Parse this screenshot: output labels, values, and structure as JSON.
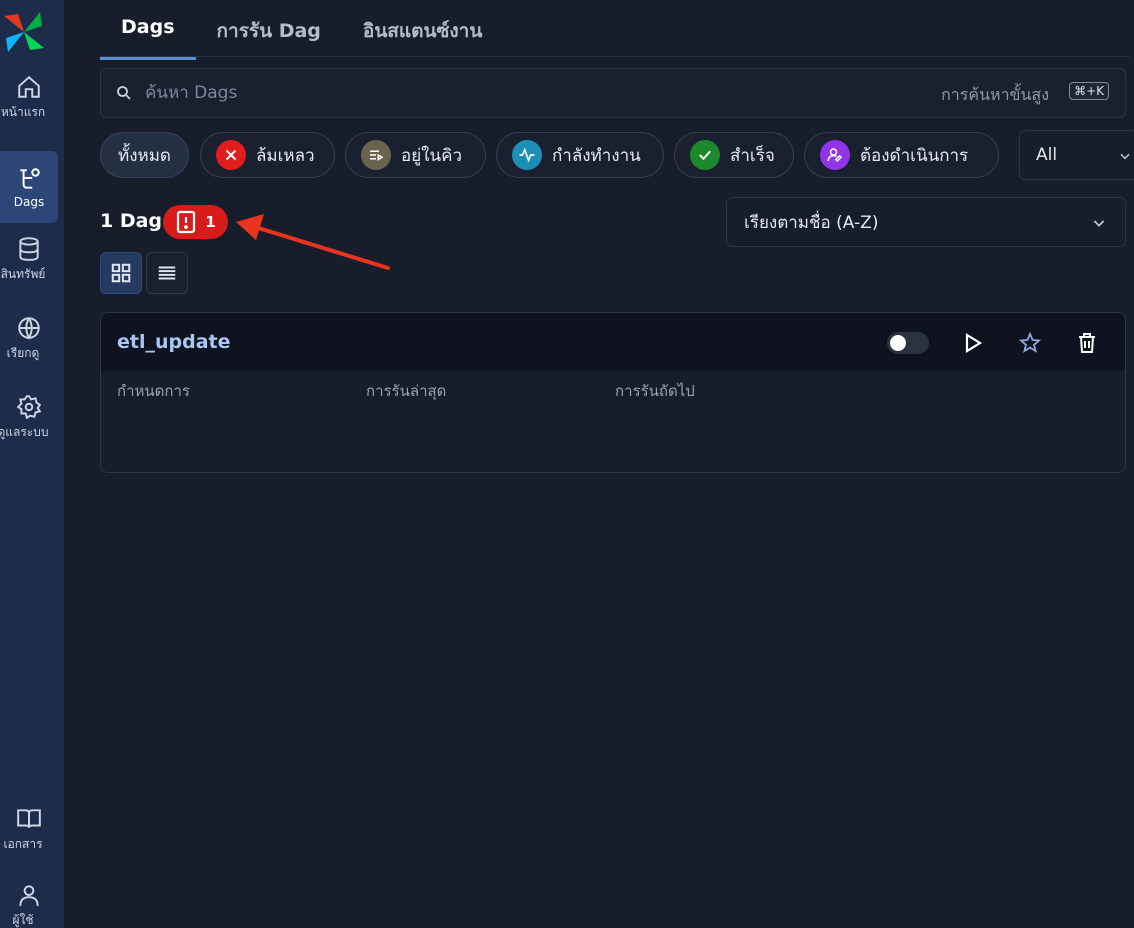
{
  "sidebar": {
    "items": [
      {
        "label": "หน้าแรก",
        "icon": "home-icon"
      },
      {
        "label": "Dags",
        "icon": "dags-icon"
      },
      {
        "label": "สินทรัพย์",
        "icon": "database-icon"
      },
      {
        "label": "เรียกดู",
        "icon": "globe-icon"
      },
      {
        "label": "ดูแลระบบ",
        "icon": "gear-icon"
      },
      {
        "label": "เอกสาร",
        "icon": "book-icon"
      },
      {
        "label": "ผู้ใช้",
        "icon": "user-icon"
      }
    ]
  },
  "tabs": [
    {
      "label": "Dags"
    },
    {
      "label": "การรัน Dag"
    },
    {
      "label": "อินสแตนซ์งาน"
    }
  ],
  "search": {
    "placeholder": "ค้นหา Dags",
    "advanced_label": "การค้นหาขั้นสูง",
    "shortcut": "⌘+K"
  },
  "filters": [
    {
      "label": "ทั้งหมด"
    },
    {
      "label": "ล้มเหลว",
      "color": "#e11d1d"
    },
    {
      "label": "อยู่ในคิว",
      "color": "#6b6250"
    },
    {
      "label": "กำลังทำงาน",
      "color": "#1c8fb8"
    },
    {
      "label": "สำเร็จ",
      "color": "#1a8a2a"
    },
    {
      "label": "ต้องดำเนินการ",
      "color": "#9333ea"
    }
  ],
  "state_select": {
    "value": "All"
  },
  "summary": {
    "count_label": "1 Dag",
    "error_count": "1"
  },
  "sort": {
    "value": "เรียงตามชื่อ (A-Z)"
  },
  "dag": {
    "name": "etl_update",
    "columns": [
      "กำหนดการ",
      "การรันล่าสุด",
      "การรันถัดไป"
    ]
  },
  "colors": {
    "accent": "#5a8fd6",
    "error": "#d81c1c",
    "sidebar_bg": "#1d2c4a"
  }
}
